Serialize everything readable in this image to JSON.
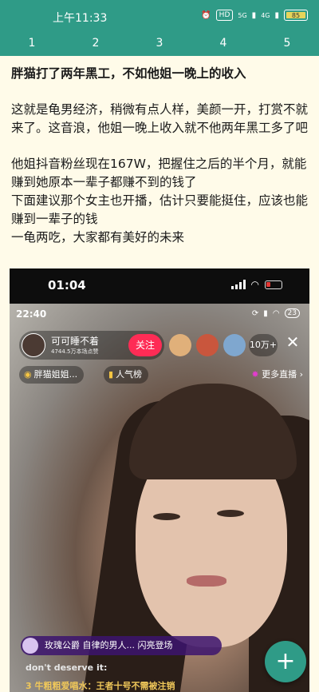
{
  "status_bar": {
    "time": "上午11:33",
    "hd": "HD",
    "net1": "5G",
    "net2": "4G",
    "battery": "85",
    "accent": "#2f9b87"
  },
  "tabs": [
    "1",
    "2",
    "3",
    "4",
    "5"
  ],
  "article": {
    "title": "胖猫打了两年黑工，不如他姐一晚上的收入",
    "para1": "这就是龟男经济，稍微有点人样，美颜一开，打赏不就来了。这音浪，他姐一晚上收入就不他两年黑工多了吧",
    "para2": "他姐抖音粉丝现在167W，把握住之后的半个月，就能赚到她原本一辈子都赚不到的钱了",
    "para3": "下面建议那个女主也开播，估计只要能挺住，应该也能赚到一辈子的钱",
    "para4": "一龟两吃，大家都有美好的未来"
  },
  "screenshot": {
    "ios_time": "01:04",
    "live_time": "22:40",
    "live_battery": "23",
    "host_name": "可可睡不着",
    "host_sub": "4744.5万本场点赞",
    "follow_label": "关注",
    "viewer_count": "10万+",
    "chip1": "胖猫姐姐...",
    "chip2": "人气榜",
    "more_live": "更多直播 ›",
    "banner": "玫瑰公爵  自律的男人... 闪亮登场",
    "comment1": "don't deserve it:",
    "comment2": "3 牛粗粗爱唱水：王者十号不需被注销"
  },
  "fab_icon": "plus-icon"
}
